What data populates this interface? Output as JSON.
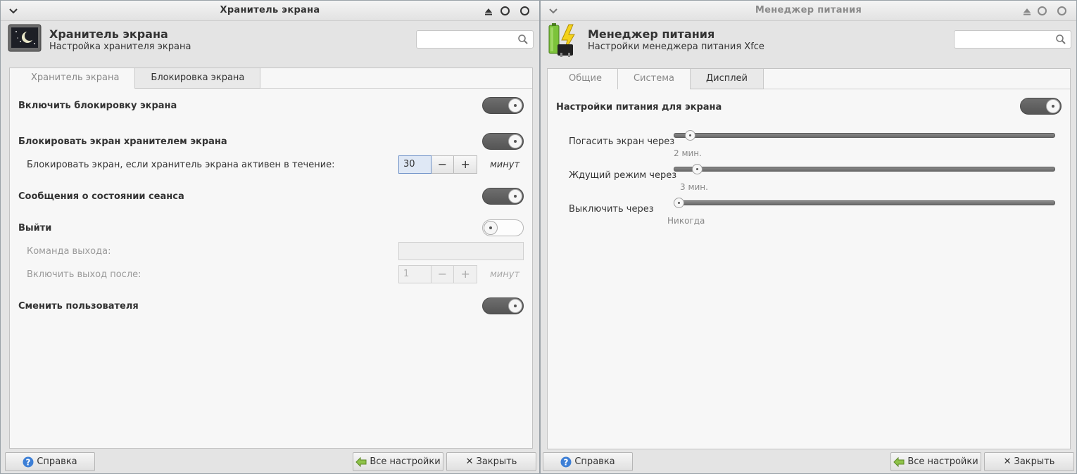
{
  "win1": {
    "title": "Хранитель экрана",
    "app_title": "Хранитель экрана",
    "app_subtitle": "Настройка хранителя экрана",
    "tabs": [
      {
        "label": "Хранитель экрана"
      },
      {
        "label": "Блокировка экрана"
      }
    ],
    "rows": {
      "enable_lock": "Включить блокировку экрана",
      "lock_with_saver": "Блокировать экран хранителем экрана",
      "lock_after_label": "Блокировать экран, если хранитель экрана активен в течение:",
      "lock_after_value": "30",
      "lock_after_unit": "минут",
      "session_messages": "Сообщения о состоянии сеанса",
      "logout": "Выйти",
      "logout_command_label": "Команда выхода:",
      "logout_after_label": "Включить выход после:",
      "logout_after_value": "1",
      "logout_after_unit": "минут",
      "switch_user": "Сменить пользователя"
    },
    "toggles": {
      "enable_lock": true,
      "lock_with_saver": true,
      "session_messages": true,
      "logout": false,
      "switch_user": true
    },
    "buttons": {
      "help": "Справка",
      "all_settings": "Все настройки",
      "close": "Закрыть"
    }
  },
  "win2": {
    "title": "Менеджер питания",
    "app_title": "Менеджер питания",
    "app_subtitle": "Настройки менеджера питания Xfce",
    "tabs": [
      {
        "label": "Общие"
      },
      {
        "label": "Система"
      },
      {
        "label": "Дисплей"
      }
    ],
    "section_title": "Настройки питания для экрана",
    "sliders": [
      {
        "label": "Погасить экран через",
        "value_text": "2 мин.",
        "fraction": 0.03
      },
      {
        "label": "Ждущий режим через",
        "value_text": "3 мин.",
        "fraction": 0.05
      },
      {
        "label": "Выключить через",
        "value_text": "Никогда",
        "fraction": 0.0
      }
    ],
    "buttons": {
      "help": "Справка",
      "all_settings": "Все настройки",
      "close": "Закрыть"
    }
  },
  "colors": {
    "toggle_on": "#5a5a5a",
    "focus": "#6b8fc7"
  }
}
